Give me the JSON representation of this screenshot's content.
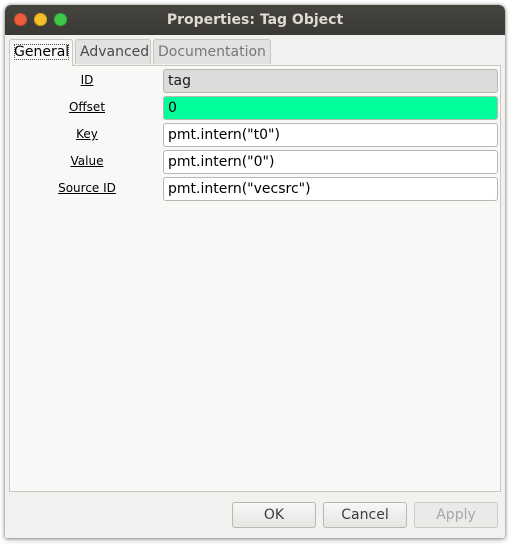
{
  "window": {
    "title": "Properties: Tag Object"
  },
  "tabs": [
    {
      "label": "General"
    },
    {
      "label": "Advanced"
    },
    {
      "label": "Documentation"
    }
  ],
  "fields": [
    {
      "label": "ID",
      "value": "tag"
    },
    {
      "label": "Offset",
      "value": "0"
    },
    {
      "label": "Key",
      "value": "pmt.intern(\"t0\")"
    },
    {
      "label": "Value",
      "value": "pmt.intern(\"0\")"
    },
    {
      "label": "Source ID",
      "value": "pmt.intern(\"vecsrc\")"
    }
  ],
  "buttons": {
    "ok": "OK",
    "cancel": "Cancel",
    "apply": "Apply"
  },
  "colors": {
    "offset_highlight": "#00ff99",
    "titlebar": "#3c3b37"
  }
}
